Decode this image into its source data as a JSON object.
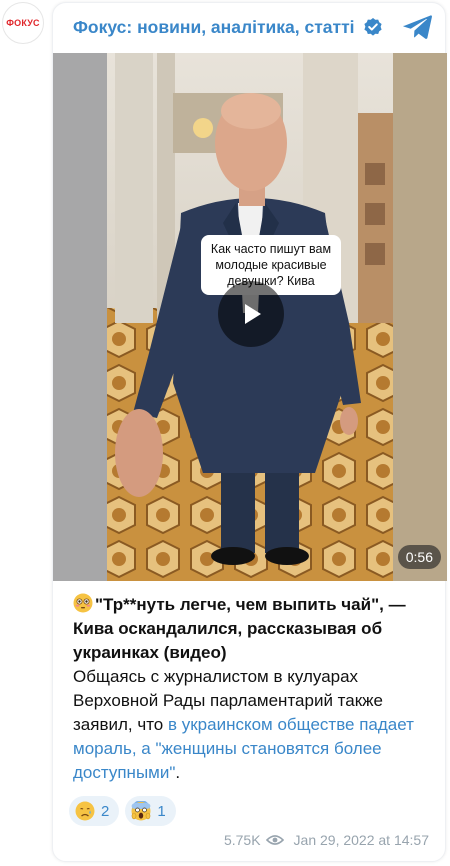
{
  "channel": {
    "avatar_text": "ФОКУС",
    "title": "Фокус: новини, аналітика, статті"
  },
  "video": {
    "overlay_text": "Как часто пишут вам молодые красивые девушки? Кива",
    "duration": "0:56"
  },
  "post": {
    "headline": "\"Тр**нуть легче, чем выпить чай\", — Кива оскандалился, рассказывая об украинках (видео)",
    "body_before_link": "Общаясь с журналистом в кулуарах Верховной Рады парламентарий также заявил, что ",
    "body_link": "в украинском обществе падает мораль, а \"женщины становятся более доступными\"",
    "body_after_link": "."
  },
  "reactions": [
    {
      "icon": "sad-face-icon",
      "count": "2"
    },
    {
      "icon": "screaming-face-icon",
      "count": "1"
    }
  ],
  "meta": {
    "views": "5.75K",
    "date": "Jan 29, 2022 at 14:57"
  },
  "colors": {
    "accent": "#3a87c9",
    "brand_red": "#e0262b",
    "reaction_bg": "#eaf2f9",
    "meta_gray": "#98a4ae"
  }
}
